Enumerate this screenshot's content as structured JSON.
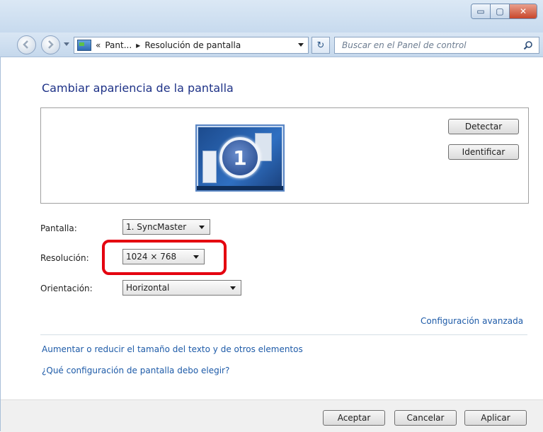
{
  "window": {
    "minimize_glyph": "▭",
    "maximize_glyph": "▢",
    "close_glyph": "✕"
  },
  "nav": {
    "address_chevron": "«",
    "address_parent": "Pant...",
    "address_separator": "▶",
    "address_current": "Resolución de pantalla",
    "refresh_glyph": "↻",
    "search_placeholder": "Buscar en el Panel de control"
  },
  "main": {
    "heading": "Cambiar apariencia de la pantalla",
    "monitor_number": "1",
    "detect_button": "Detectar",
    "identify_button": "Identificar",
    "display_label": "Pantalla:",
    "display_value": "1. SyncMaster",
    "resolution_label": "Resolución:",
    "resolution_value": "1024 × 768",
    "orientation_label": "Orientación:",
    "orientation_value": "Horizontal",
    "advanced_link": "Configuración avanzada",
    "text_size_link": "Aumentar o reducir el tamaño del texto y de otros elementos",
    "help_link": "¿Qué configuración de pantalla debo elegir?"
  },
  "footer": {
    "ok_button": "Aceptar",
    "cancel_button": "Cancelar",
    "apply_button": "Aplicar"
  },
  "colors": {
    "heading": "#1e3287",
    "link": "#1e5ba8",
    "highlight": "#e4000f"
  }
}
